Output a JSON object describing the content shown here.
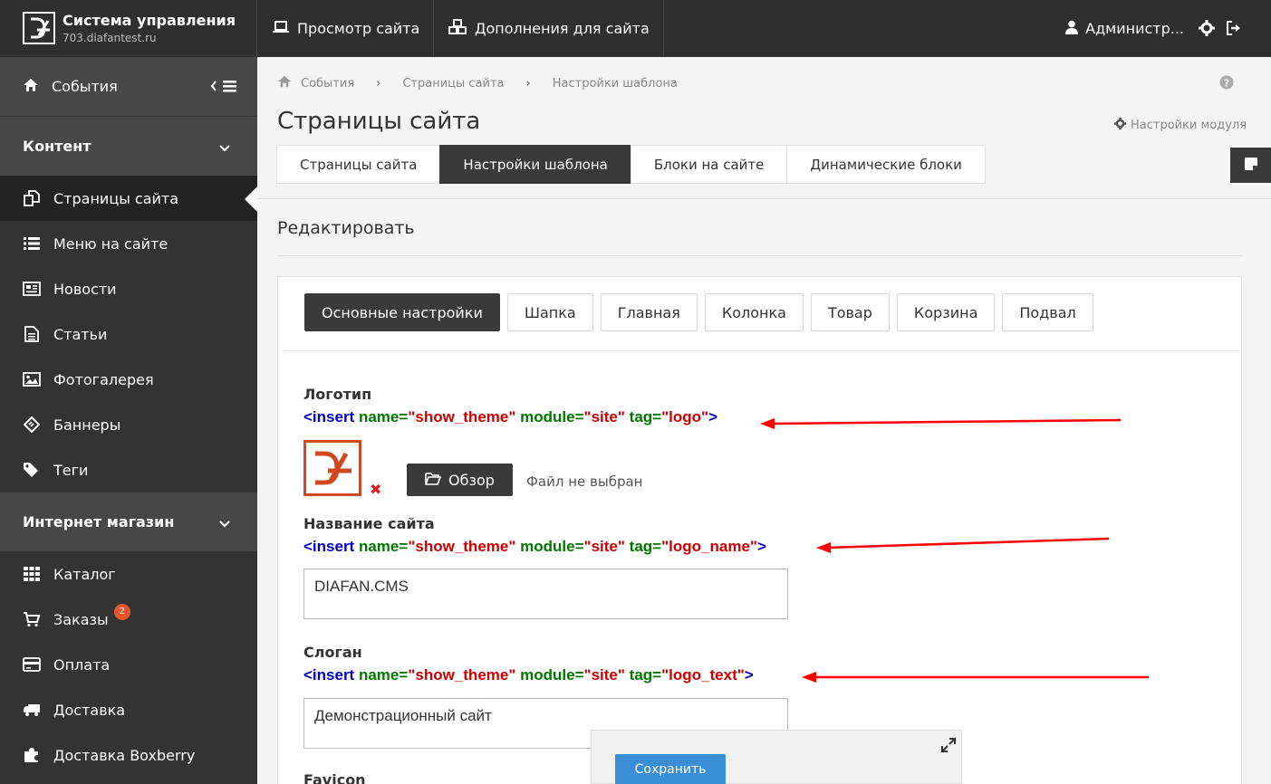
{
  "brand": {
    "title": "Система управления",
    "subtitle": "703.diafantest.ru"
  },
  "topnav": {
    "view_site": "Просмотр сайта",
    "addons": "Дополнения для сайта",
    "user": "Администр..."
  },
  "sidebar": {
    "events": "События",
    "content_section": "Контент",
    "content_items": [
      {
        "label": "Страницы сайта",
        "icon": "pages-icon"
      },
      {
        "label": "Меню на сайте",
        "icon": "list-icon"
      },
      {
        "label": "Новости",
        "icon": "newspaper-icon"
      },
      {
        "label": "Статьи",
        "icon": "document-icon"
      },
      {
        "label": "Фотогалерея",
        "icon": "image-icon"
      },
      {
        "label": "Баннеры",
        "icon": "ticket-icon"
      },
      {
        "label": "Теги",
        "icon": "tags-icon"
      }
    ],
    "shop_section": "Интернет магазин",
    "shop_items": [
      {
        "label": "Каталог",
        "icon": "grid-icon"
      },
      {
        "label": "Заказы",
        "icon": "cart-icon",
        "badge": "2"
      },
      {
        "label": "Оплата",
        "icon": "credit-card-icon"
      },
      {
        "label": "Доставка",
        "icon": "truck-icon"
      },
      {
        "label": "Доставка Boxberry",
        "icon": "puzzle-icon"
      }
    ]
  },
  "breadcrumb": [
    "События",
    "Страницы сайта",
    "Настройки шаблона"
  ],
  "page": {
    "title": "Страницы сайта",
    "module_settings": "Настройки модуля",
    "edit_title": "Редактировать"
  },
  "tabs": [
    "Страницы сайта",
    "Настройки шаблона",
    "Блоки на сайте",
    "Динамические блоки"
  ],
  "subtabs": [
    "Основные настройки",
    "Шапка",
    "Главная",
    "Колонка",
    "Товар",
    "Корзина",
    "Подвал"
  ],
  "fields": {
    "logo": {
      "label": "Логотип",
      "code": {
        "open": "<insert",
        "name_attr": "name=",
        "name_val": "\"show_theme\"",
        "module_attr": "module=",
        "module_val": "\"site\"",
        "tag_attr": "tag=",
        "tag_val": "\"logo\"",
        "close": ">"
      },
      "browse": "Обзор",
      "file_status": "Файл не выбран"
    },
    "site_name": {
      "label": "Название сайта",
      "code": {
        "open": "<insert",
        "name_attr": "name=",
        "name_val": "\"show_theme\"",
        "module_attr": "module=",
        "module_val": "\"site\"",
        "tag_attr": "tag=",
        "tag_val": "\"logo_name\"",
        "close": ">"
      },
      "value": "DIAFAN.CMS"
    },
    "slogan": {
      "label": "Слоган",
      "code": {
        "open": "<insert",
        "name_attr": "name=",
        "name_val": "\"show_theme\"",
        "module_attr": "module=",
        "module_val": "\"site\"",
        "tag_attr": "tag=",
        "tag_val": "\"logo_text\"",
        "close": ">"
      },
      "value": "Демонстрационный сайт"
    },
    "favicon": {
      "label": "Favicon"
    }
  },
  "save": {
    "label": "Сохранить"
  },
  "colors": {
    "dark": "#3a3a3a",
    "sidebar": "#333333",
    "accent": "#3a8ed6",
    "logo": "#d0481f",
    "arrow": "#ff0000"
  }
}
